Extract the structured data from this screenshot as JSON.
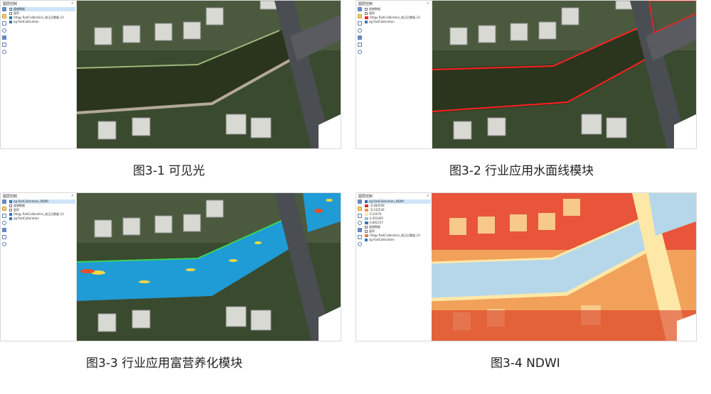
{
  "panels": {
    "p1": {
      "caption": "图3-1 可见光",
      "sidebar_title": "图层控制",
      "layers": [
        "遥感数据",
        "面积",
        "fatigy RadCalibration_校正后数据 (2)",
        "ag RadCalibration"
      ]
    },
    "p2": {
      "caption": "图3-2 行业应用水面线模块",
      "sidebar_title": "图层控制",
      "layers": [
        "遥感数据",
        "面积",
        "fatigy RadCalibration_校正后数据 (2)",
        "ag RadCalibration"
      ]
    },
    "p3": {
      "caption": "图3-3 行业应用富营养化模块",
      "sidebar_title": "图层控制",
      "layers": [
        "ag RadCalibration_NDWI",
        "遥感数据",
        "面积",
        "fatigy RadCalibration_校正后数据 (2)",
        "ag RadCalibration"
      ]
    },
    "p4": {
      "caption": "图3-4 NDWI",
      "sidebar_title": "图层控制",
      "layers": [
        "ag RadCalibration_NDWI",
        "-0.484500",
        "-0.142530",
        "0.21074",
        "0.452465",
        "0.892157",
        "遥感数据",
        "面积",
        "fatigy RadCalibration_校正后数据 (2)",
        "ag RadCalibration"
      ]
    }
  },
  "colors": {
    "ndwi_low": "#d7301f",
    "ndwi_mid": "#fee8a8",
    "ndwi_high": "#91bfdb",
    "water_index": "#1f9bd6",
    "waterline": "#ff2020"
  }
}
